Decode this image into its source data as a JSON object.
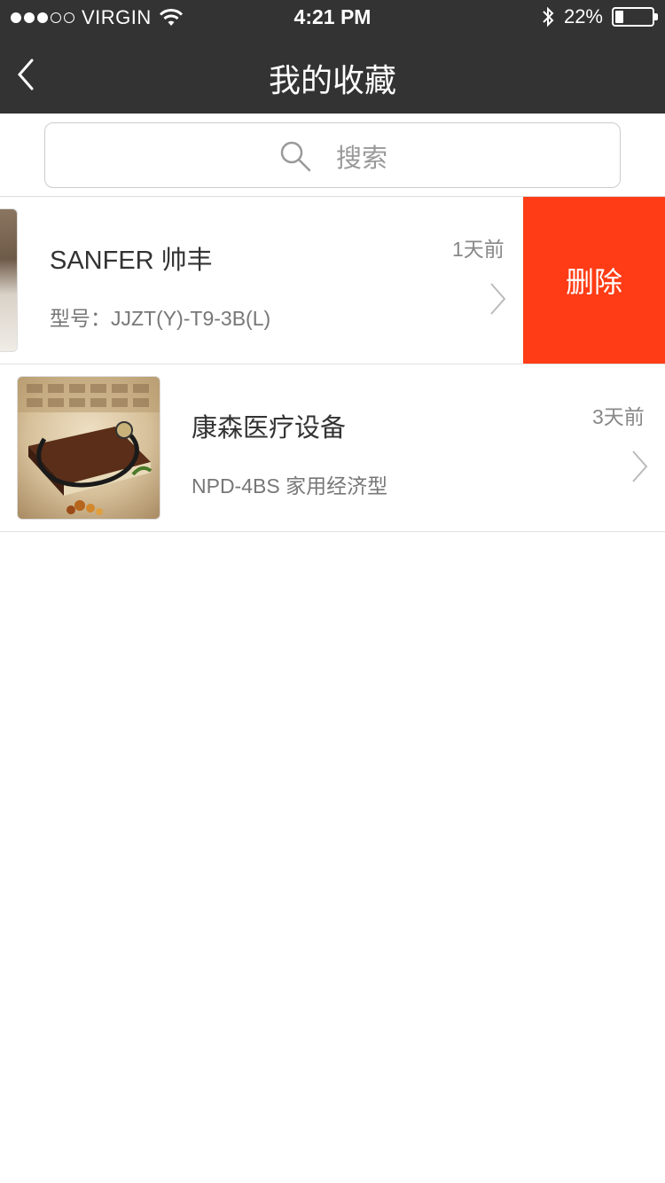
{
  "status_bar": {
    "carrier": "VIRGIN",
    "time": "4:21 PM",
    "battery": "22%",
    "battery_level": 0.22,
    "signal_bars": 3,
    "signal_total": 5
  },
  "nav": {
    "title": "我的收藏",
    "back_icon": "chevron-left-icon"
  },
  "search": {
    "placeholder": "搜索",
    "icon": "search-icon"
  },
  "colors": {
    "topbar": "#333333",
    "delete": "#ff3c15"
  },
  "favorites": [
    {
      "title": "SANFER  帅丰",
      "subtitle": "型号：JJZT(Y)-T9-3B(L)",
      "time": "1天前",
      "delete_label": "删除"
    },
    {
      "title": "康森医疗设备",
      "subtitle": "NPD-4BS 家用经济型",
      "time": "3天前"
    }
  ]
}
